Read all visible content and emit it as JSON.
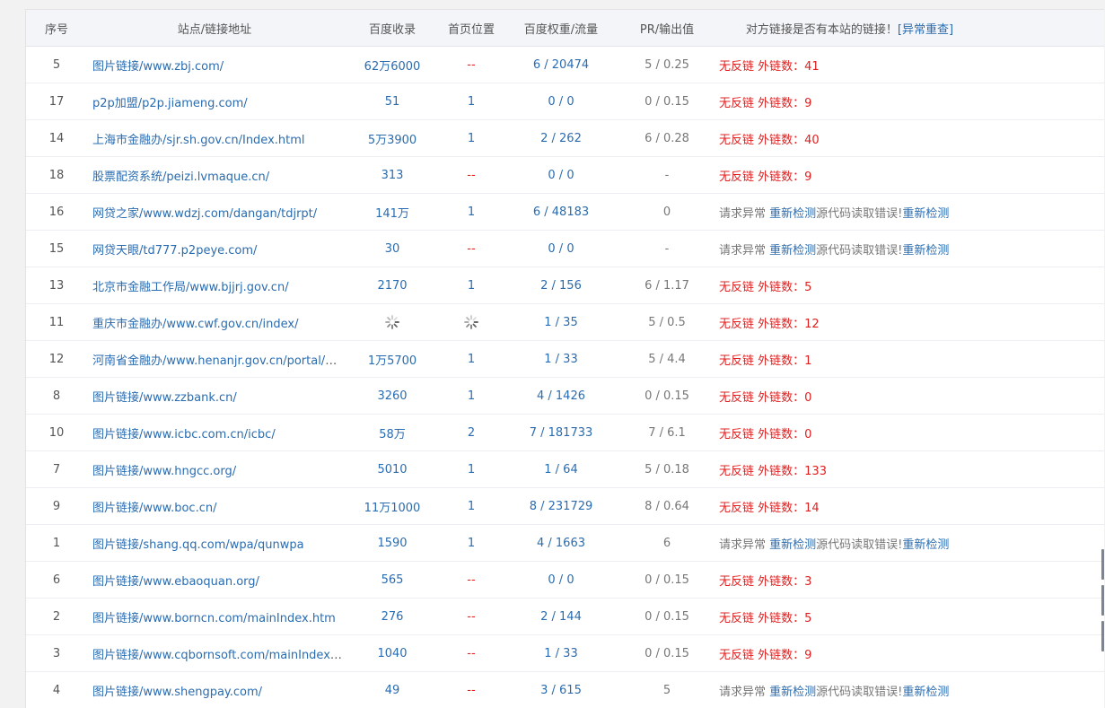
{
  "table": {
    "headers": {
      "idx": "序号",
      "site": "站点/链接地址",
      "baidu_index": "百度收录",
      "home_pos": "首页位置",
      "weight": "百度权重/流量",
      "pr": "PR/输出值",
      "backlink": "对方链接是否有本站的链接！",
      "recheck": "[异常重查]"
    },
    "rows": [
      {
        "idx": "5",
        "site": "图片链接/www.zbj.com/",
        "baidu_index": "62万6000",
        "home_pos": "--",
        "weight": "6 / 20474",
        "pr": "5 / 0.25",
        "status": "ok",
        "no_backlink": "无反链",
        "outlinks": "外链数：41"
      },
      {
        "idx": "17",
        "site": "p2p加盟/p2p.jiameng.com/",
        "baidu_index": "51",
        "home_pos": "1",
        "weight": "0 / 0",
        "pr": "0 / 0.15",
        "status": "ok",
        "no_backlink": "无反链",
        "outlinks": "外链数：9"
      },
      {
        "idx": "14",
        "site": "上海市金融办/sjr.sh.gov.cn/Index.html",
        "baidu_index": "5万3900",
        "home_pos": "1",
        "weight": "2 / 262",
        "pr": "6 / 0.28",
        "status": "ok",
        "no_backlink": "无反链",
        "outlinks": "外链数：40"
      },
      {
        "idx": "18",
        "site": "股票配资系统/peizi.lvmaque.cn/",
        "baidu_index": "313",
        "home_pos": "--",
        "weight": "0 / 0",
        "pr": "-",
        "status": "ok",
        "no_backlink": "无反链",
        "outlinks": "外链数：9"
      },
      {
        "idx": "16",
        "site": "网贷之家/www.wdzj.com/dangan/tdjrpt/",
        "baidu_index": "141万",
        "home_pos": "1",
        "weight": "6 / 48183",
        "pr": "0",
        "status": "error",
        "err1": "请求异常",
        "recheck1": "重新检测",
        "err2": "源代码读取错误!",
        "recheck2": "重新检测"
      },
      {
        "idx": "15",
        "site": "网贷天眼/td777.p2peye.com/",
        "baidu_index": "30",
        "home_pos": "--",
        "weight": "0 / 0",
        "pr": "-",
        "status": "error",
        "err1": "请求异常",
        "recheck1": "重新检测",
        "err2": "源代码读取错误!",
        "recheck2": "重新检测"
      },
      {
        "idx": "13",
        "site": "北京市金融工作局/www.bjjrj.gov.cn/",
        "baidu_index": "2170",
        "home_pos": "1",
        "weight": "2 / 156",
        "pr": "6 / 1.17",
        "status": "ok",
        "no_backlink": "无反链",
        "outlinks": "外链数：5"
      },
      {
        "idx": "11",
        "site": "重庆市金融办/www.cwf.gov.cn/index/",
        "baidu_index": "",
        "home_pos": "",
        "weight": "1 / 35",
        "pr": "5 / 0.5",
        "status": "ok",
        "no_backlink": "无反链",
        "outlinks": "外链数：12",
        "loading": true
      },
      {
        "idx": "12",
        "site": "河南省金融办/www.henanjr.gov.cn/portal/g...",
        "baidu_index": "1万5700",
        "home_pos": "1",
        "weight": "1 / 33",
        "pr": "5 / 4.4",
        "status": "ok",
        "no_backlink": "无反链",
        "outlinks": "外链数：1"
      },
      {
        "idx": "8",
        "site": "图片链接/www.zzbank.cn/",
        "baidu_index": "3260",
        "home_pos": "1",
        "weight": "4 / 1426",
        "pr": "0 / 0.15",
        "status": "ok",
        "no_backlink": "无反链",
        "outlinks": "外链数：0"
      },
      {
        "idx": "10",
        "site": "图片链接/www.icbc.com.cn/icbc/",
        "baidu_index": "58万",
        "home_pos": "2",
        "weight": "7 / 181733",
        "pr": "7 / 6.1",
        "status": "ok",
        "no_backlink": "无反链",
        "outlinks": "外链数：0"
      },
      {
        "idx": "7",
        "site": "图片链接/www.hngcc.org/",
        "baidu_index": "5010",
        "home_pos": "1",
        "weight": "1 / 64",
        "pr": "5 / 0.18",
        "status": "ok",
        "no_backlink": "无反链",
        "outlinks": "外链数：133"
      },
      {
        "idx": "9",
        "site": "图片链接/www.boc.cn/",
        "baidu_index": "11万1000",
        "home_pos": "1",
        "weight": "8 / 231729",
        "pr": "8 / 0.64",
        "status": "ok",
        "no_backlink": "无反链",
        "outlinks": "外链数：14"
      },
      {
        "idx": "1",
        "site": "图片链接/shang.qq.com/wpa/qunwpa",
        "baidu_index": "1590",
        "home_pos": "1",
        "weight": "4 / 1663",
        "pr": "6",
        "status": "error",
        "err1": "请求异常",
        "recheck1": "重新检测",
        "err2": "源代码读取错误!",
        "recheck2": "重新检测"
      },
      {
        "idx": "6",
        "site": "图片链接/www.ebaoquan.org/",
        "baidu_index": "565",
        "home_pos": "--",
        "weight": "0 / 0",
        "pr": "0 / 0.15",
        "status": "ok",
        "no_backlink": "无反链",
        "outlinks": "外链数：3"
      },
      {
        "idx": "2",
        "site": "图片链接/www.borncn.com/mainIndex.htm",
        "baidu_index": "276",
        "home_pos": "--",
        "weight": "2 / 144",
        "pr": "0 / 0.15",
        "status": "ok",
        "no_backlink": "无反链",
        "outlinks": "外链数：5"
      },
      {
        "idx": "3",
        "site": "图片链接/www.cqbornsoft.com/mainIndex....",
        "baidu_index": "1040",
        "home_pos": "--",
        "weight": "1 / 33",
        "pr": "0 / 0.15",
        "status": "ok",
        "no_backlink": "无反链",
        "outlinks": "外链数：9"
      },
      {
        "idx": "4",
        "site": "图片链接/www.shengpay.com/",
        "baidu_index": "49",
        "home_pos": "--",
        "weight": "3 / 615",
        "pr": "5",
        "status": "error",
        "err1": "请求异常",
        "recheck1": "重新检测",
        "err2": "源代码读取错误!",
        "recheck2": "重新检测"
      }
    ]
  },
  "colors": {
    "link": "#2a6cb0",
    "alert": "#e02020",
    "muted": "#777777",
    "header_bg": "#f3f5f8"
  },
  "icons": {
    "loading": "loading-spinner-icon"
  }
}
